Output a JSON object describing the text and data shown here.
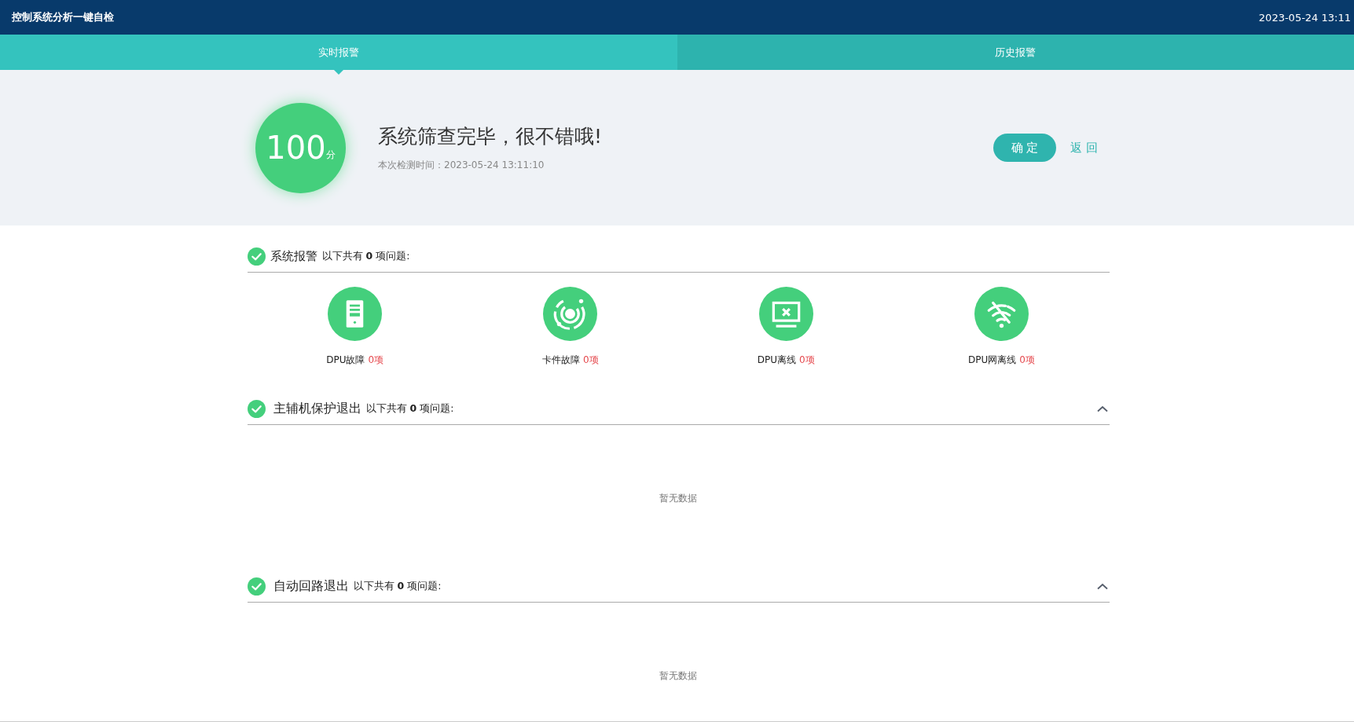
{
  "header": {
    "title": "控制系统分析一键自检",
    "datetime": "2023-05-24 13:11"
  },
  "tabs": [
    {
      "label": "实时报警",
      "selected": true
    },
    {
      "label": "历史报警",
      "selected": false
    }
  ],
  "result": {
    "score": "100",
    "unit": "分",
    "message": "系统筛查完毕，很不错哦!",
    "time": "本次检测时间：2023-05-24 13:11:10",
    "confirm": "确 定",
    "back": "返 回"
  },
  "sections": [
    {
      "kind": "icons",
      "passed": true,
      "title": "系统报警",
      "summary": "以下共有 **0** 项问题:",
      "items": [
        {
          "kind": "server",
          "label": "DPU故障",
          "count": "0项"
        },
        {
          "kind": "orbit",
          "label": "卡件故障",
          "count": "0项"
        },
        {
          "kind": "monitor",
          "label": "DPU离线",
          "count": "0项"
        },
        {
          "kind": "wifi",
          "label": "DPU网离线",
          "count": "0项"
        }
      ]
    },
    {
      "kind": "list",
      "passed": true,
      "expanded": true,
      "title": "主辅机保护退出",
      "summary": "以下共有 **0** 项问题:",
      "empty_text": "暂无数据"
    },
    {
      "kind": "list",
      "passed": true,
      "expanded": true,
      "title": "自动回路退出",
      "summary": "以下共有 **0** 项问题:",
      "empty_text": "暂无数据"
    }
  ]
}
